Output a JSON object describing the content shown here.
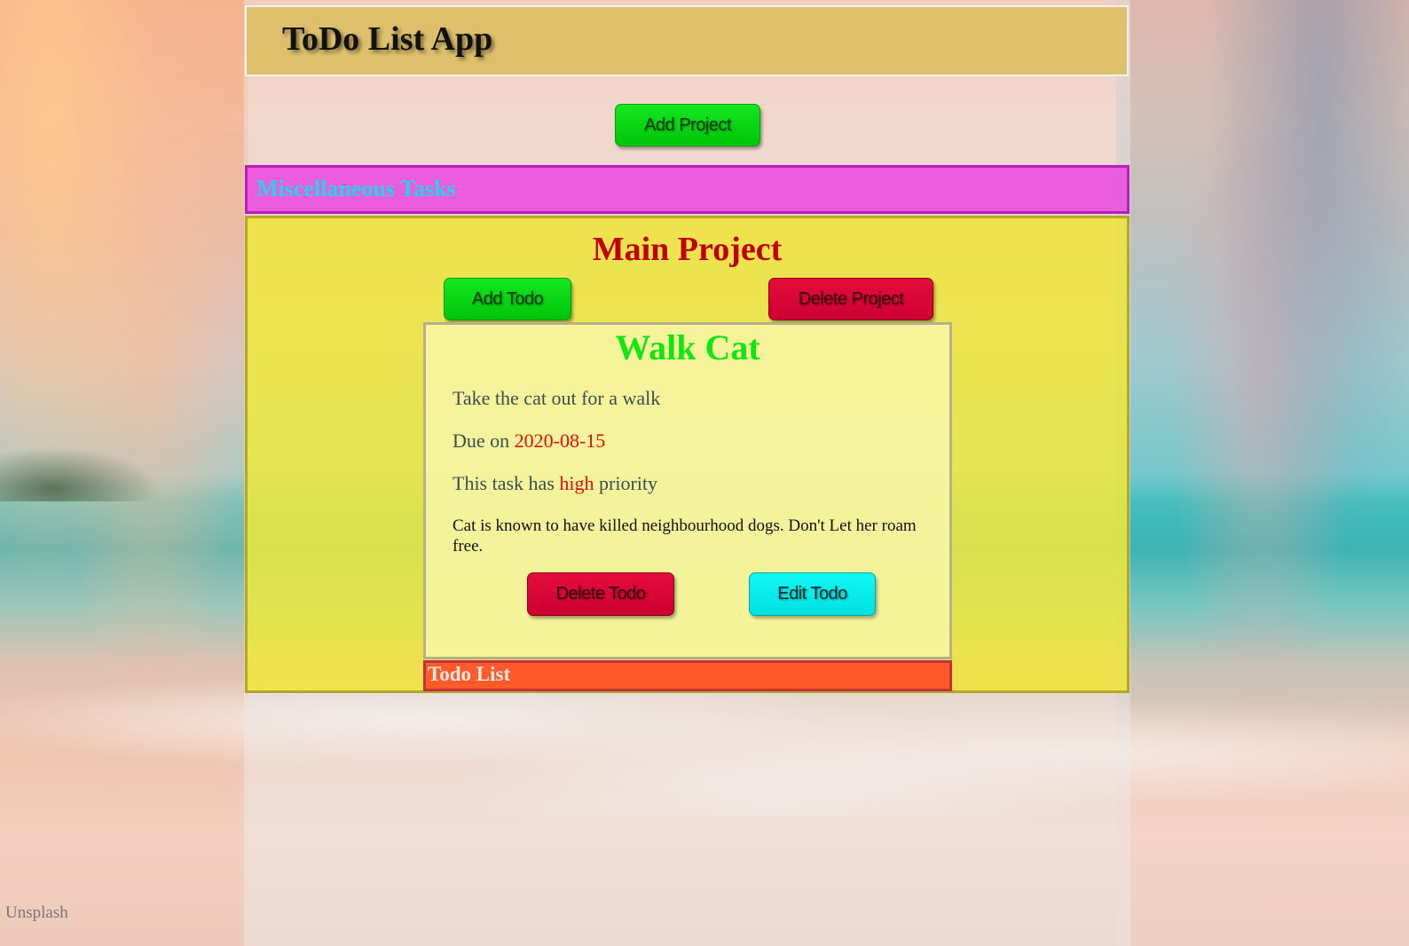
{
  "app": {
    "title": "ToDo List App"
  },
  "toolbar": {
    "add_project_label": "Add Project"
  },
  "projects_nav": {
    "items": [
      {
        "label": "Miscellaneous Tasks"
      }
    ]
  },
  "project": {
    "title": "Main Project",
    "add_todo_label": "Add Todo",
    "delete_project_label": "Delete Project",
    "todo": {
      "title": "Walk Cat",
      "description": "Take the cat out for a walk",
      "due_prefix": "Due on ",
      "due_date": "2020-08-15",
      "priority_prefix": "This task has ",
      "priority": "high",
      "priority_suffix": " priority",
      "notes": "Cat is known to have killed neighbourhood dogs. Don't Let her roam free.",
      "delete_label": "Delete Todo",
      "edit_label": "Edit Todo"
    },
    "todo_list_label": "Todo List"
  },
  "background": {
    "attribution": "Unsplash"
  },
  "colors": {
    "header_bg": "#dcbe64",
    "misc_bar_bg": "#eb46e1",
    "misc_bar_text": "#26d4e8",
    "project_bg": "#f0e628",
    "project_title": "#c00000",
    "todo_title": "#12e612",
    "due_date": "#e01010",
    "priority": "#e01010",
    "todo_list_bar": "#ff5a2a",
    "btn_green": "#14e81e",
    "btn_red": "#e60d3c",
    "btn_cyan": "#11f6f6"
  }
}
